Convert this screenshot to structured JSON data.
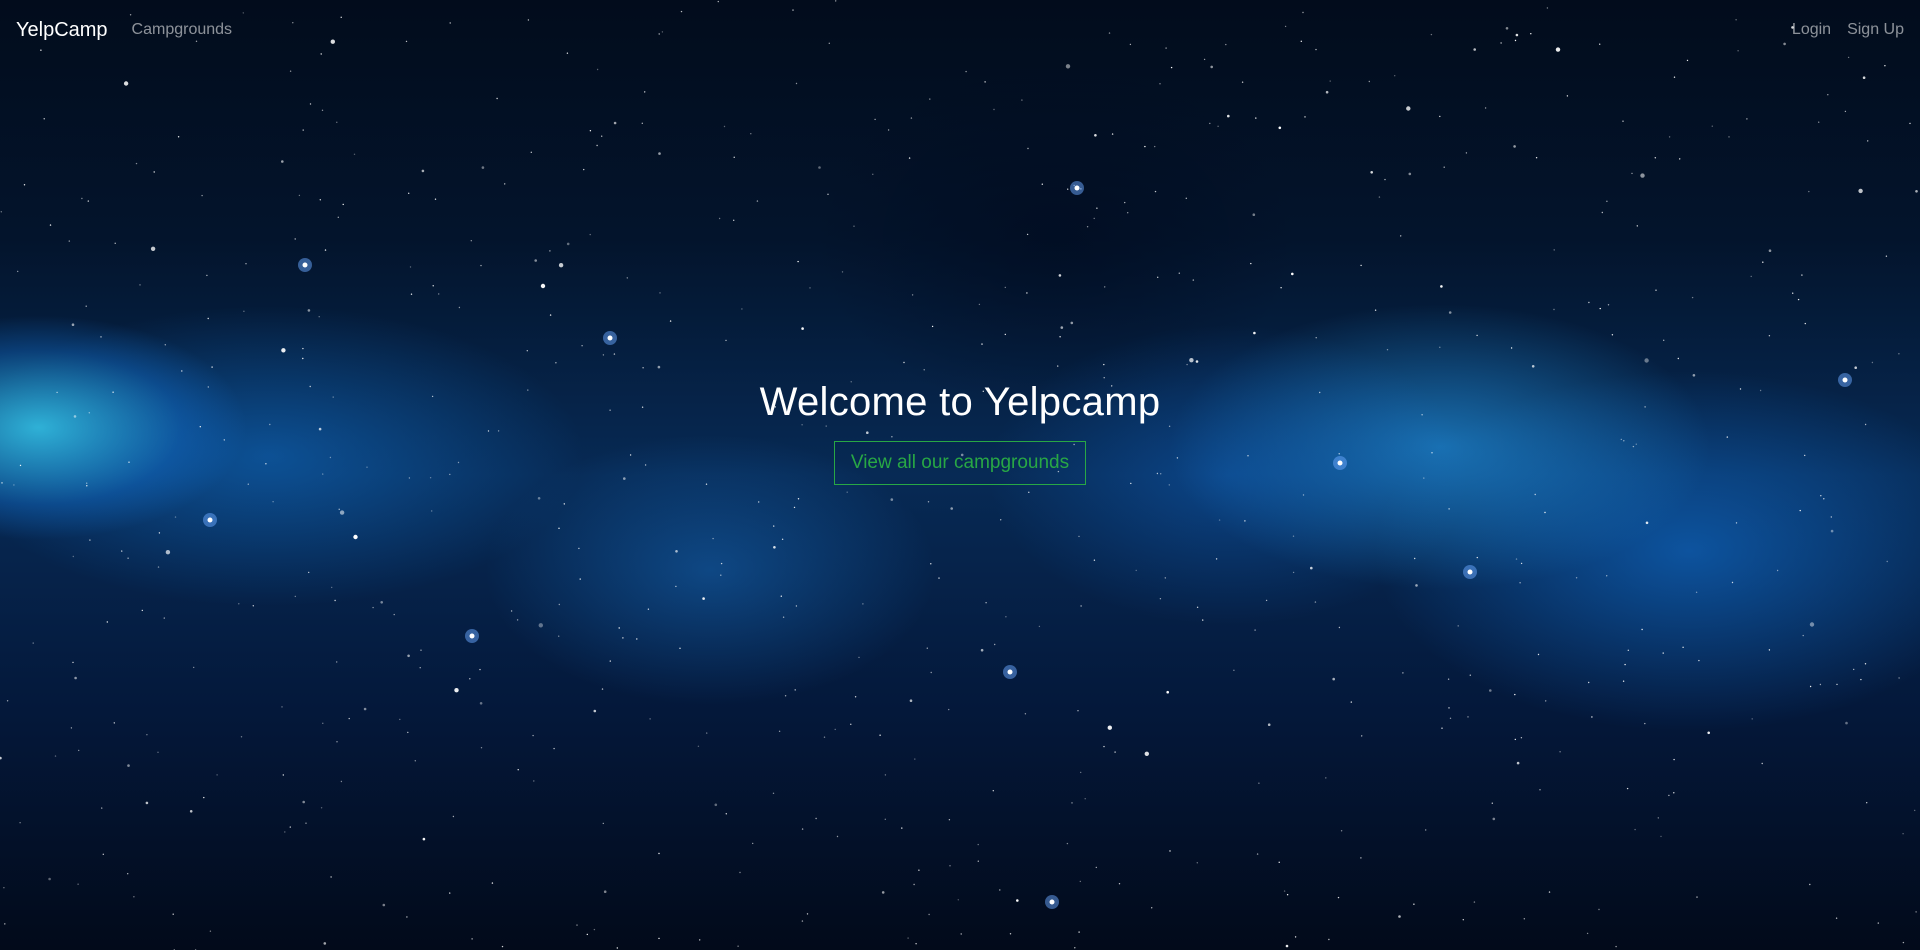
{
  "navbar": {
    "brand": "YelpCamp",
    "links": {
      "campgrounds": "Campgrounds"
    },
    "auth": {
      "login": "Login",
      "signup": "Sign Up"
    }
  },
  "hero": {
    "title": "Welcome to Yelpcamp",
    "cta_label": "View all our campgrounds"
  },
  "colors": {
    "accent": "#28a745",
    "text": "#ffffff",
    "muted_link": "#8a95a5"
  }
}
